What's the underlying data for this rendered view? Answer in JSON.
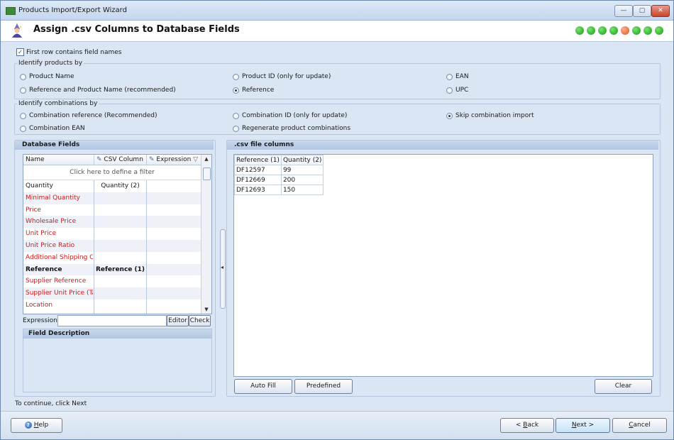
{
  "window": {
    "title": "Products Import/Export Wizard",
    "minimize": "—",
    "maximize": "▢",
    "close": "✕"
  },
  "header": {
    "title": "Assign .csv Columns to Database Fields",
    "steps": [
      {
        "state": "done"
      },
      {
        "state": "done"
      },
      {
        "state": "done"
      },
      {
        "state": "done"
      },
      {
        "state": "current"
      },
      {
        "state": "todo"
      },
      {
        "state": "todo"
      },
      {
        "state": "todo"
      }
    ],
    "colors": {
      "done": "#1d9a18",
      "current": "#e0502a"
    }
  },
  "first_row": {
    "label": "First row contains field names",
    "checked": true,
    "mark": "✓"
  },
  "identify_products": {
    "label": "Identify products by",
    "options": [
      {
        "label": "Product Name",
        "selected": false
      },
      {
        "label": "Product ID (only for update)",
        "selected": false
      },
      {
        "label": "EAN",
        "selected": false
      },
      {
        "label": "Reference and Product Name (recommended)",
        "selected": false
      },
      {
        "label": "Reference",
        "selected": true
      },
      {
        "label": "UPC",
        "selected": false
      }
    ]
  },
  "identify_combinations": {
    "label": "Identify combinations by",
    "options": [
      {
        "label": "Combination reference (Recommended)",
        "selected": false
      },
      {
        "label": "Combination ID (only for update)",
        "selected": false
      },
      {
        "label": "Skip combination import",
        "selected": true
      },
      {
        "label": "Combination EAN",
        "selected": false
      },
      {
        "label": "Regenerate product combinations",
        "selected": false
      }
    ]
  },
  "db_fields": {
    "title": "Database Fields",
    "columns": {
      "name": "Name",
      "csv": "CSV Column",
      "expr": "Expression",
      "filter_icon": "▽"
    },
    "filter_hint": "Click here to define a filter",
    "rows": [
      {
        "name": "Quantity",
        "csv": "Quantity (2)",
        "style": "normal"
      },
      {
        "name": "Minimal Quantity",
        "csv": "",
        "style": "red"
      },
      {
        "name": "Price",
        "csv": "",
        "style": "red"
      },
      {
        "name": "Wholesale Price",
        "csv": "",
        "style": "red"
      },
      {
        "name": "Unit Price",
        "csv": "",
        "style": "red"
      },
      {
        "name": "Unit Price Ratio",
        "csv": "",
        "style": "red"
      },
      {
        "name": "Additional Shipping Cost",
        "csv": "",
        "style": "red"
      },
      {
        "name": "Reference",
        "csv": "Reference (1)",
        "style": "bold"
      },
      {
        "name": "Supplier Reference",
        "csv": "",
        "style": "red"
      },
      {
        "name": "Supplier Unit Price (Tax",
        "csv": "",
        "style": "red"
      },
      {
        "name": "Location",
        "csv": "",
        "style": "red"
      }
    ],
    "expression_label": "Expression",
    "expression_value": "",
    "editor_btn": "Editor",
    "check_btn": "Check",
    "field_description": "Field Description"
  },
  "csv": {
    "title": ".csv file columns",
    "headers": [
      "Reference (1)",
      "Quantity (2)"
    ],
    "rows": [
      [
        "DF12597",
        "99"
      ],
      [
        "DF12669",
        "200"
      ],
      [
        "DF12693",
        "150"
      ]
    ],
    "auto_fill": "Auto Fill",
    "predefined": "Predefined",
    "clear": "Clear"
  },
  "footer": {
    "message": "To continue, click Next",
    "help": {
      "prefix": "",
      "ul": "H",
      "rest": "elp"
    },
    "back": {
      "prefix": "< ",
      "ul": "B",
      "rest": "ack"
    },
    "next": {
      "prefix": "",
      "ul": "N",
      "rest": "ext >"
    },
    "cancel": {
      "prefix": "",
      "ul": "C",
      "rest": "ancel"
    }
  }
}
